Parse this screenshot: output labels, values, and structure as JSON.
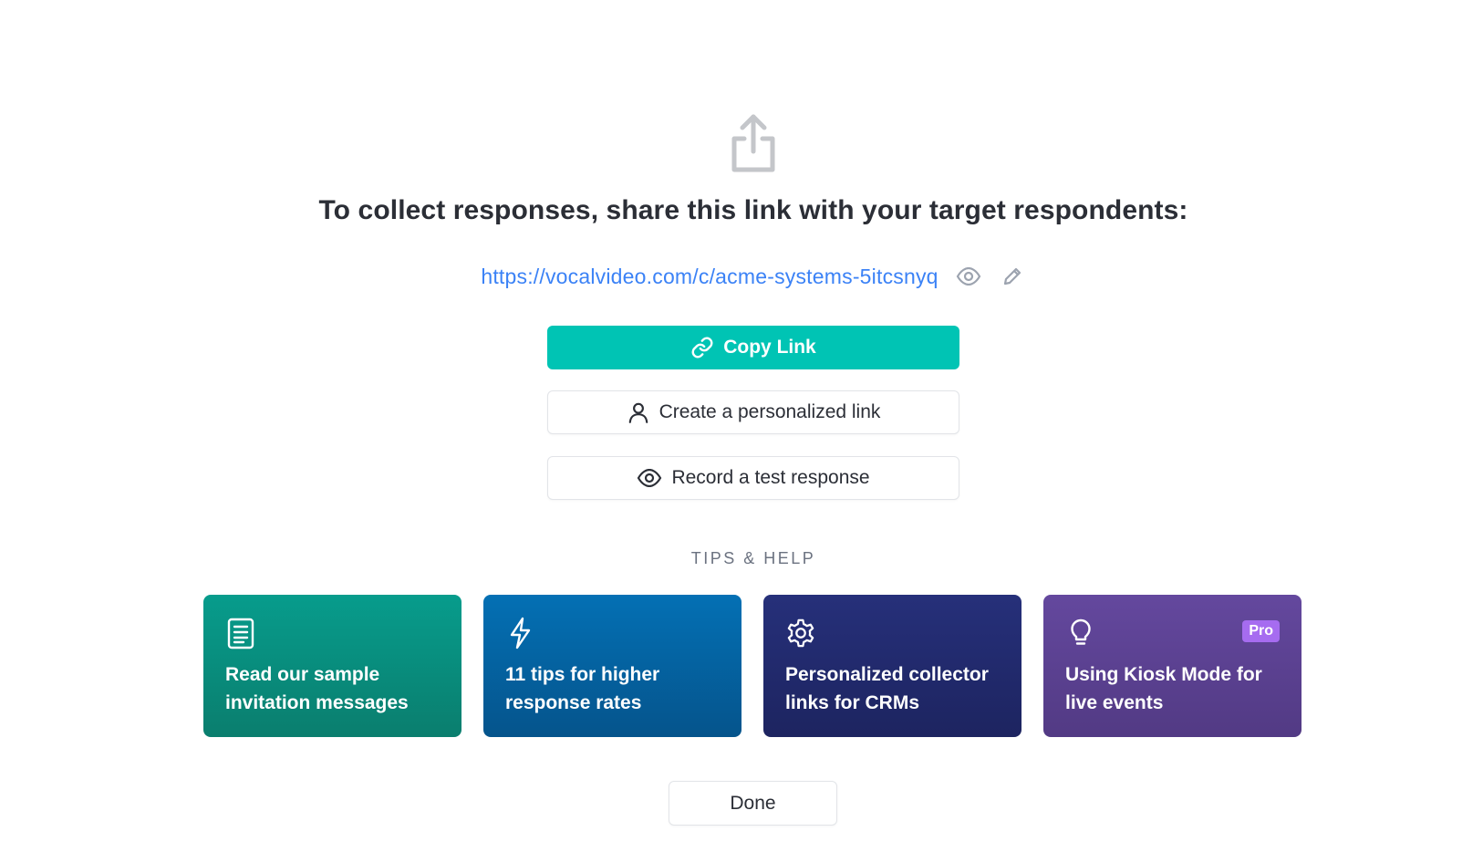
{
  "header": {
    "icon": "share-upload-icon",
    "title": "To collect responses, share this link with your target respondents:"
  },
  "link": {
    "url": "https://vocalvideo.com/c/acme-systems-5itcsnyq",
    "preview_icon": "eye-icon",
    "edit_icon": "pencil-icon"
  },
  "actions": {
    "copy_link": {
      "label": "Copy Link",
      "icon": "link-icon"
    },
    "personalized_link": {
      "label": "Create a personalized link",
      "icon": "user-icon"
    },
    "test_response": {
      "label": "Record a test response",
      "icon": "eye-icon"
    }
  },
  "tips": {
    "section_label": "TIPS & HELP",
    "cards": [
      {
        "label": "Read our sample invitation messages",
        "icon": "document-icon",
        "color": "#079c8c"
      },
      {
        "label": "11 tips for higher response rates",
        "icon": "lightning-icon",
        "color": "#0470b4"
      },
      {
        "label": "Personalized collector links for CRMs",
        "icon": "gear-icon",
        "color": "#26307a"
      },
      {
        "label": "Using Kiosk Mode for live events",
        "icon": "lightbulb-icon",
        "color": "#64489e",
        "badge": "Pro"
      }
    ]
  },
  "footer": {
    "done_label": "Done"
  },
  "colors": {
    "primary": "#00c4b4",
    "link": "#3b82f6",
    "badge": "#a66cf0"
  }
}
